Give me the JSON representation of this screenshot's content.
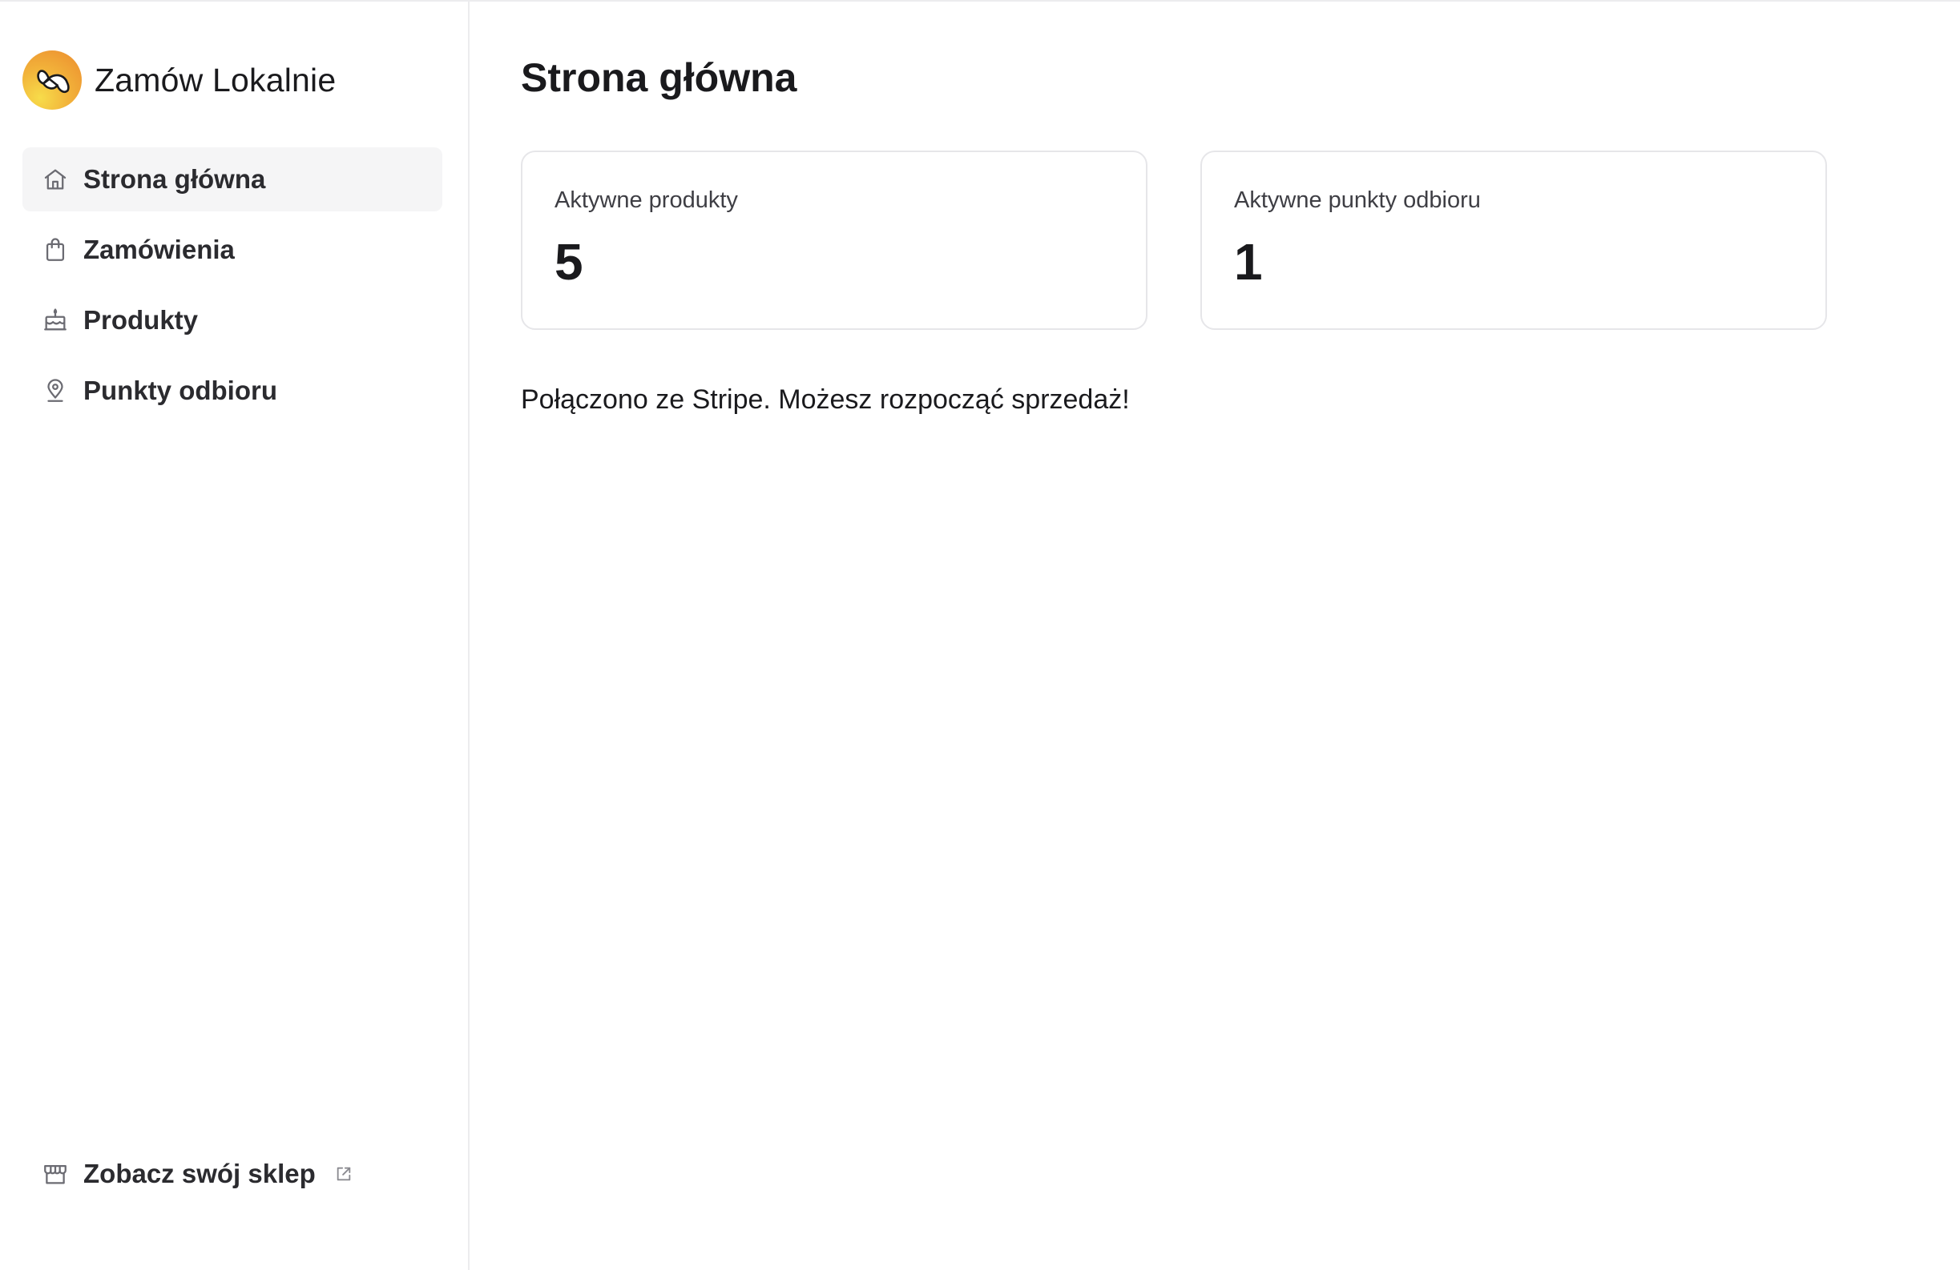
{
  "brand": {
    "name": "Zamów Lokalnie",
    "logo_icon": "croissant-icon",
    "logo_colors": [
      "#f7dc4a",
      "#f2b33a",
      "#ec8a2e"
    ]
  },
  "sidebar": {
    "items": [
      {
        "label": "Strona główna",
        "icon": "home-icon",
        "active": true
      },
      {
        "label": "Zamówienia",
        "icon": "shopping-bag-icon",
        "active": false
      },
      {
        "label": "Produkty",
        "icon": "cake-icon",
        "active": false
      },
      {
        "label": "Punkty odbioru",
        "icon": "map-pin-icon",
        "active": false
      }
    ],
    "footer": {
      "label": "Zobacz swój sklep",
      "icon": "storefront-icon",
      "trailing_icon": "external-link-icon"
    }
  },
  "main": {
    "title": "Strona główna",
    "stats": [
      {
        "label": "Aktywne produkty",
        "value": "5"
      },
      {
        "label": "Aktywne punkty odbioru",
        "value": "1"
      }
    ],
    "status_message": "Połączono ze Stripe. Możesz rozpocząć sprzedaż!"
  },
  "colors": {
    "active_nav_bg": "#f5f5f6",
    "border": "#e6e6e9",
    "text": "#1a1a1d",
    "icon": "#6b6b72"
  }
}
